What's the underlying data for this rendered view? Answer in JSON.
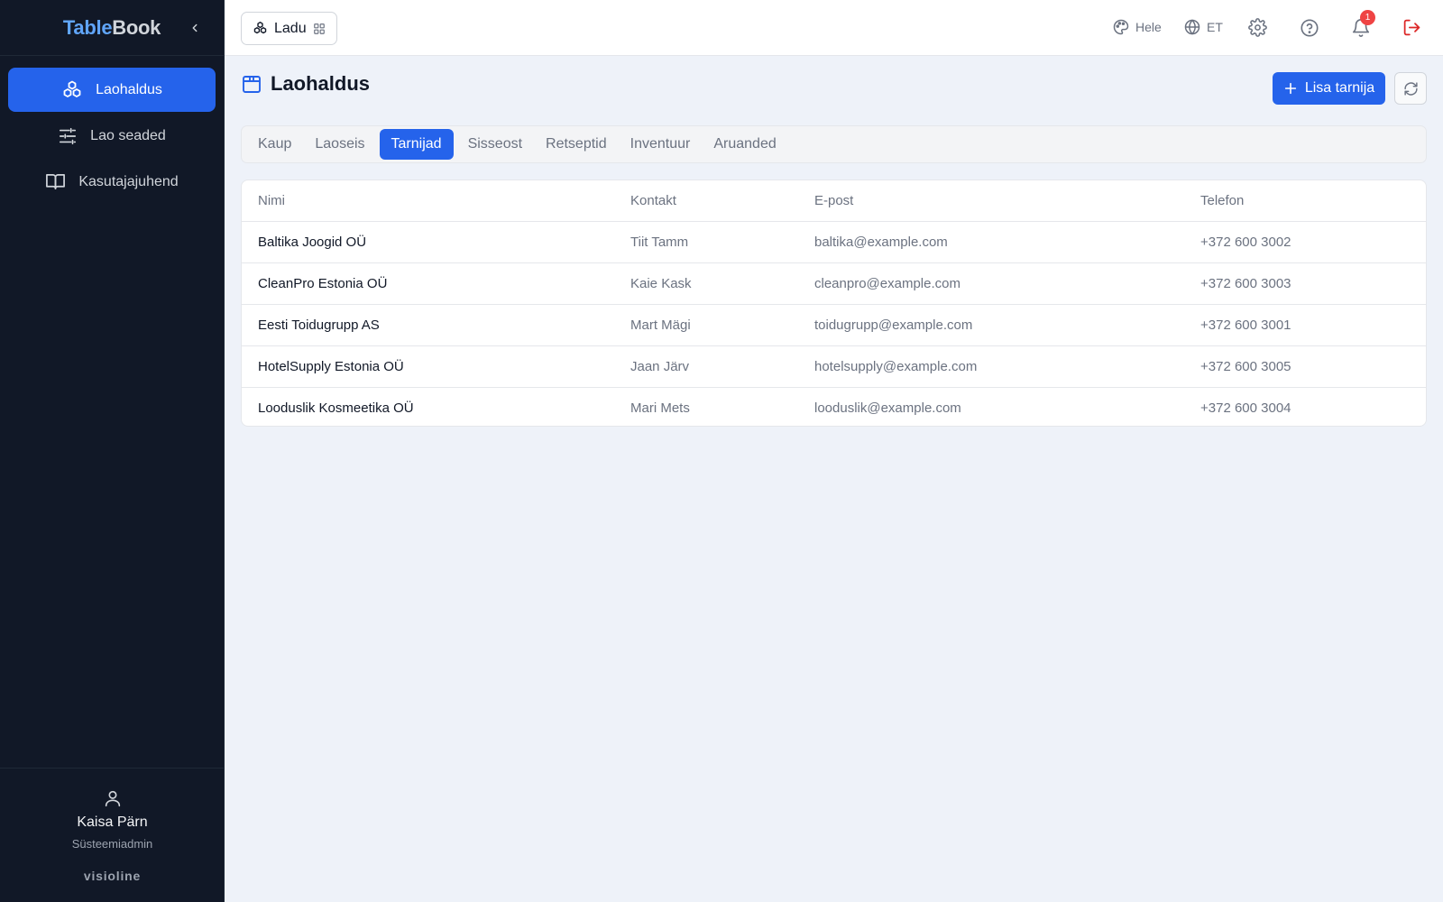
{
  "app": {
    "logo_part1": "Table",
    "logo_part2": "Book"
  },
  "sidebar": {
    "items": [
      {
        "label": "Laohaldus",
        "icon": "boxes-icon",
        "active": true
      },
      {
        "label": "Lao seaded",
        "icon": "sliders-icon",
        "active": false
      },
      {
        "label": "Kasutajajuhend",
        "icon": "book-icon",
        "active": false
      }
    ],
    "user": {
      "name": "Kaisa Pärn",
      "role": "Süsteemiadmin"
    },
    "brand": "visioline"
  },
  "topbar": {
    "module_label": "Ladu",
    "theme_label": "Hele",
    "language_label": "ET",
    "notification_count": "1"
  },
  "page": {
    "title": "Laohaldus",
    "add_button_label": "Lisa tarnija"
  },
  "tabs": [
    {
      "label": "Kaup",
      "active": false
    },
    {
      "label": "Laoseis",
      "active": false
    },
    {
      "label": "Tarnijad",
      "active": true
    },
    {
      "label": "Sisseost",
      "active": false
    },
    {
      "label": "Retseptid",
      "active": false
    },
    {
      "label": "Inventuur",
      "active": false
    },
    {
      "label": "Aruanded",
      "active": false
    }
  ],
  "table": {
    "columns": [
      "Nimi",
      "Kontakt",
      "E-post",
      "Telefon"
    ],
    "rows": [
      [
        "Baltika Joogid OÜ",
        "Tiit Tamm",
        "baltika@example.com",
        "+372 600 3002"
      ],
      [
        "CleanPro Estonia OÜ",
        "Kaie Kask",
        "cleanpro@example.com",
        "+372 600 3003"
      ],
      [
        "Eesti Toidugrupp AS",
        "Mart Mägi",
        "toidugrupp@example.com",
        "+372 600 3001"
      ],
      [
        "HotelSupply Estonia OÜ",
        "Jaan Järv",
        "hotelsupply@example.com",
        "+372 600 3005"
      ],
      [
        "Looduslik Kosmeetika OÜ",
        "Mari Mets",
        "looduslik@example.com",
        "+372 600 3004"
      ]
    ]
  },
  "colors": {
    "primary": "#2563eb",
    "sidebar_bg": "#111827",
    "logout": "#dc2626",
    "badge": "#ef4444"
  }
}
